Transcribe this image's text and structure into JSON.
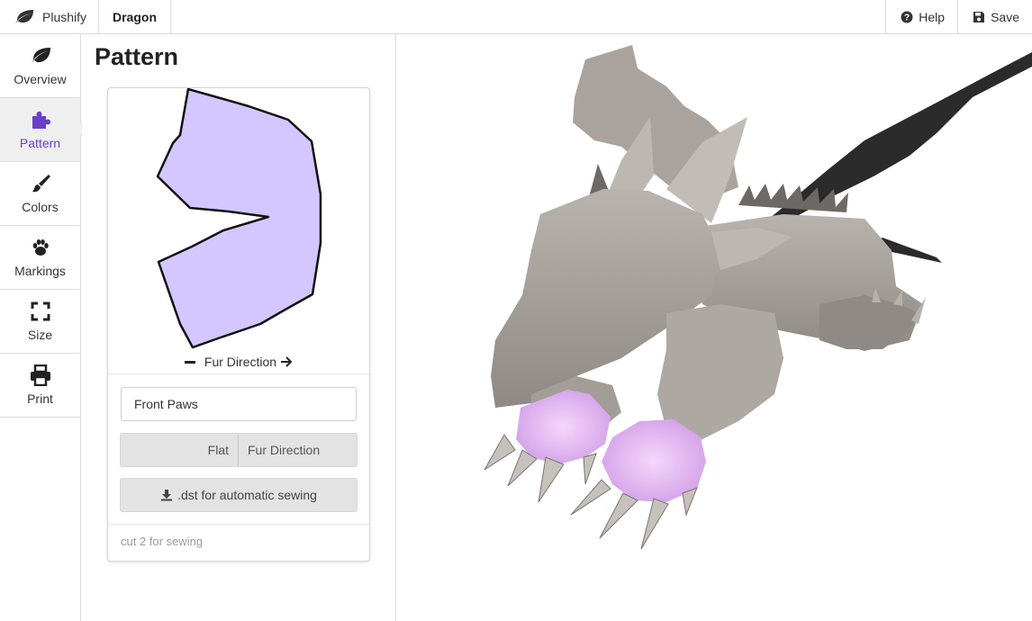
{
  "topbar": {
    "brand": "Plushify",
    "tab": "Dragon",
    "help_label": "Help",
    "save_label": "Save"
  },
  "nav": {
    "items": [
      {
        "label": "Overview",
        "icon": "leaf-icon"
      },
      {
        "label": "Pattern",
        "icon": "puzzle-icon",
        "active": true
      },
      {
        "label": "Colors",
        "icon": "paintbrush-icon"
      },
      {
        "label": "Markings",
        "icon": "paw-icon"
      },
      {
        "label": "Size",
        "icon": "expand-icon"
      },
      {
        "label": "Print",
        "icon": "printer-icon"
      }
    ]
  },
  "panel": {
    "title": "Pattern",
    "legend_label": "Fur Direction",
    "piece_name": "Front Paws",
    "toggle": {
      "flat": "Flat",
      "fur": "Fur Direction"
    },
    "dst_label": ".dst for automatic sewing",
    "note": "cut 2 for sewing"
  },
  "colors": {
    "accent": "#6a3fc9",
    "pattern_fill": "#d4c6ff",
    "paw_pink": "#e9b7f2",
    "body_gray": "#a9a39d"
  }
}
